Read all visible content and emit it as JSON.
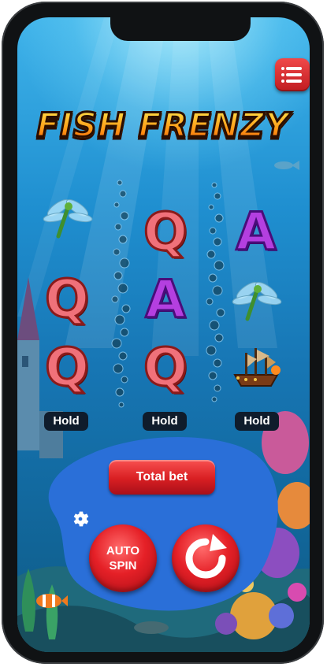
{
  "game": {
    "title": "FISH FRENZY"
  },
  "reels": {
    "grid": [
      [
        "dragonfly",
        "Q",
        "A"
      ],
      [
        "Q",
        "A",
        "dragonfly"
      ],
      [
        "Q",
        "Q",
        "ship"
      ]
    ]
  },
  "hold_buttons": [
    "Hold",
    "Hold",
    "Hold"
  ],
  "controls": {
    "total_bet_label": "Total bet",
    "auto_spin_line1": "AUTO",
    "auto_spin_line2": "SPIN"
  },
  "colors": {
    "accent_red": "#d81e22",
    "panel_blue": "#2a6fd8",
    "title_orange": "#ff9b16"
  },
  "icons": [
    "menu-icon",
    "settings-gear-icon",
    "spin-arrow-icon"
  ]
}
